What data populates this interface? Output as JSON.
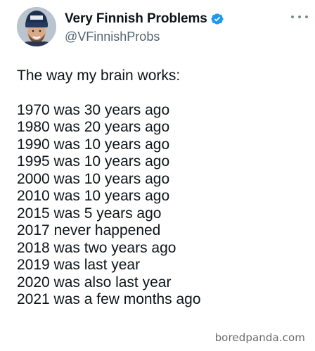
{
  "tweet": {
    "display_name": "Very Finnish Problems",
    "handle": "@VFinnishProbs",
    "verified": true,
    "intro": "The way my brain works:",
    "lines": [
      "1970 was 30 years ago",
      "1980 was 20 years ago",
      "1990 was 10 years ago",
      "1995 was 10 years ago",
      "2000 was 10 years ago",
      "2010 was 10 years ago",
      "2015 was 5 years ago",
      "2017 never happened",
      "2018 was two years ago",
      "2019 was last year",
      "2020 was also last year",
      "2021 was a few months ago"
    ]
  },
  "watermark": "boredpanda.com",
  "colors": {
    "verified_badge": "#1d9bf0",
    "text": "#0f1419",
    "handle": "#536471"
  },
  "icons": {
    "avatar": "avatar-icon",
    "verified": "verified-badge-icon",
    "more": "more-options-icon"
  }
}
